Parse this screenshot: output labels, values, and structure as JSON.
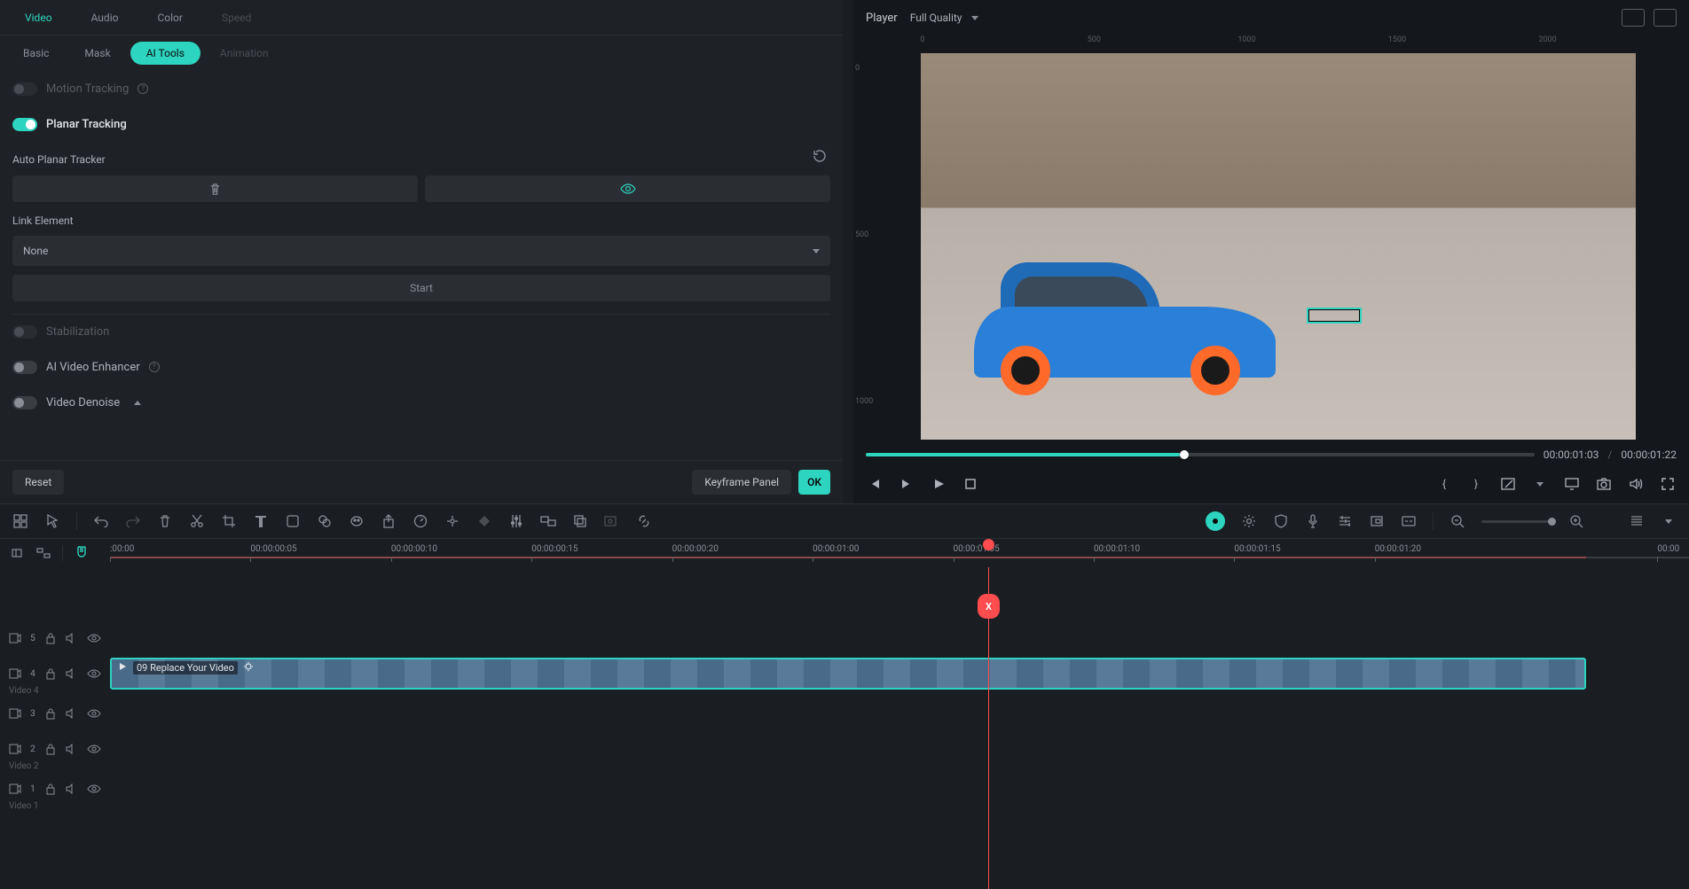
{
  "tabs_primary": {
    "video": "Video",
    "audio": "Audio",
    "color": "Color",
    "speed": "Speed"
  },
  "tabs_secondary": {
    "basic": "Basic",
    "mask": "Mask",
    "ai_tools": "AI Tools",
    "animation": "Animation"
  },
  "panel": {
    "motion_tracking": "Motion Tracking",
    "planar_tracking": "Planar Tracking",
    "auto_planar": "Auto Planar Tracker",
    "link_element": "Link Element",
    "link_value": "None",
    "start_btn": "Start",
    "stabilization": "Stabilization",
    "ai_enhancer": "AI Video Enhancer",
    "video_denoise": "Video Denoise",
    "reset": "Reset",
    "keyframe_panel": "Keyframe Panel",
    "ok": "OK"
  },
  "player": {
    "label": "Player",
    "quality": "Full Quality",
    "ruler_top": [
      "0",
      "500",
      "1000",
      "1500",
      "2000"
    ],
    "ruler_left": [
      "0",
      "500",
      "1000"
    ],
    "time_current": "00:00:01:03",
    "time_total": "00:00:01:22",
    "scrub_pct": 47
  },
  "timeline": {
    "ticks": [
      ":00:00",
      "00:00:00:05",
      "00:00:00:10",
      "00:00:00:15",
      "00:00:00:20",
      "00:00:01:00",
      "00:00:01:05",
      "00:00:01:10",
      "00:00:01:15",
      "00:00:01:20",
      "00:00"
    ],
    "playhead_label": "X",
    "clip_title": "09 Replace Your Video",
    "tracks": [
      {
        "num": "5",
        "label": ""
      },
      {
        "num": "4",
        "label": "Video 4",
        "clip": true
      },
      {
        "num": "3",
        "label": ""
      },
      {
        "num": "2",
        "label": "Video 2"
      },
      {
        "num": "1",
        "label": "Video 1"
      }
    ]
  }
}
